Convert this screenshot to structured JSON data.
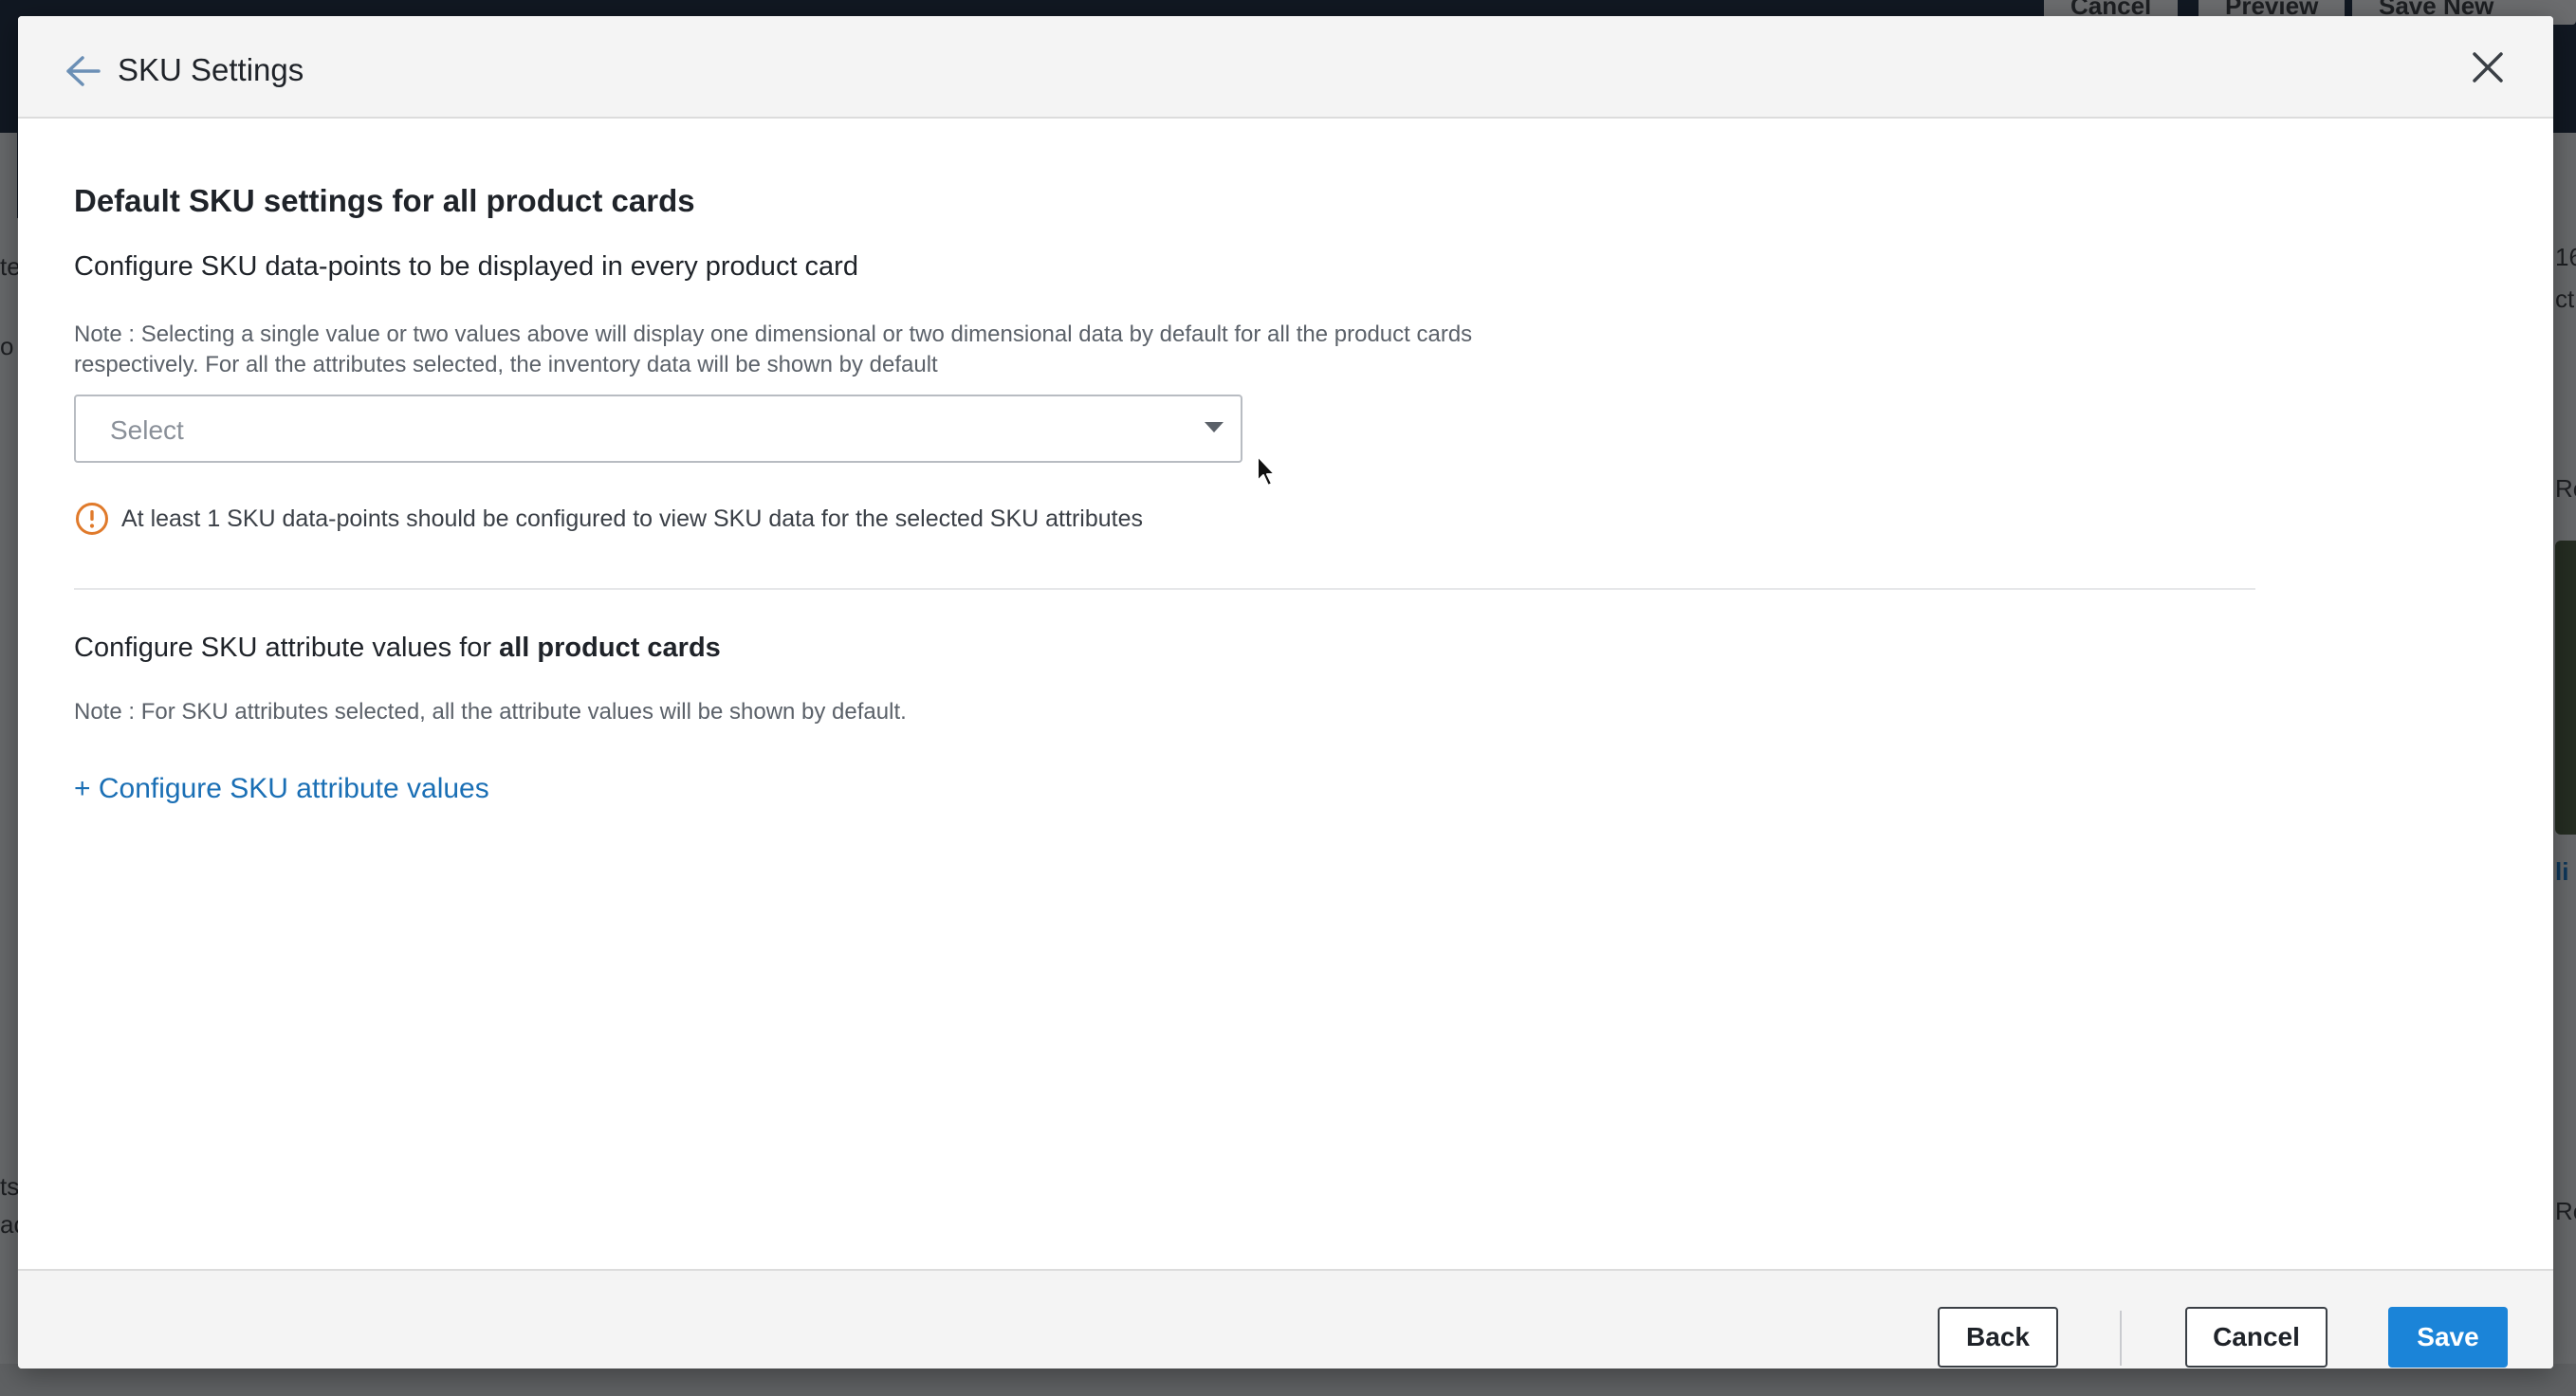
{
  "background": {
    "top_buttons": [
      "Cancel",
      "Preview",
      "Save New Test"
    ],
    "fragments": {
      "left_te": "te",
      "left_o": "o",
      "left_ts": "ts",
      "left_ac": "ac",
      "right_16": "16",
      "right_ct": "ct:",
      "right_re1": "Re",
      "right_li": "li",
      "right_re2": "Re"
    }
  },
  "modal": {
    "title": "SKU Settings",
    "section_title": "Default SKU settings for all product cards",
    "section_sub": "Configure SKU data-points to be displayed in every product card",
    "note": "Note : Selecting a single value or two values above will display one dimensional or two dimensional data by default for all the product cards respectively. For all the attributes selected, the inventory data will be shown by default",
    "select": {
      "placeholder": "Select",
      "value": ""
    },
    "warning": "At least 1 SKU data-points should be configured to view SKU data for the selected SKU attributes",
    "section2_title_prefix": "Configure SKU attribute values for ",
    "section2_title_bold": "all product cards",
    "note2": "Note : For SKU attributes selected, all the attribute values will be shown by default.",
    "configure_link": "+ Configure SKU attribute values"
  },
  "footer": {
    "back_label": "Back",
    "cancel_label": "Cancel",
    "save_label": "Save"
  },
  "colors": {
    "accent": "#1b84d8",
    "link": "#1a6fb5",
    "warning": "#e07a2b"
  }
}
